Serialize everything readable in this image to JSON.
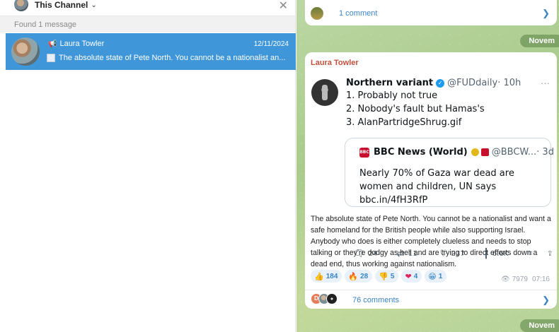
{
  "search": {
    "channel_label": "This Channel",
    "found_label": "Found 1 message",
    "result": {
      "author": "Laura Towler",
      "date": "12/11/2024",
      "snippet": "The absolute state of Pete North. You cannot be a nationalist an..."
    }
  },
  "chat": {
    "top_card": {
      "comments": "1 comment"
    },
    "date_pill_top": "Novem",
    "date_pill_bottom": "Novem",
    "message": {
      "author": "Laura Towler",
      "tweet": {
        "name": "Northern variant",
        "handle": "@FUDdaily",
        "time": "· 10h",
        "lines": [
          "1. Probably not true",
          "2. Nobody's fault but Hamas's",
          "3. AlanPartridgeShrug.gif"
        ],
        "quote": {
          "name": "BBC News (World)",
          "handle": "@BBCW...",
          "time": "· 3d",
          "text": "Nearly 70% of Gaza war dead are women and children, UN says bbc.in/4fH3RfP"
        },
        "stats": {
          "replies": "24",
          "retweets": "11",
          "likes": "237",
          "views": "6.6K"
        }
      },
      "body": "The absolute state of Pete North. You cannot be a nationalist and want a safe homeland for the British people while also supporting Israel. Anybody who does is either completely clueless and needs to stop talking or they're dodgy as hell and are trying to direct efforts down a dead end, thus working against nationalism.",
      "reactions": [
        {
          "emoji": "👍",
          "count": "184"
        },
        {
          "emoji": "🔥",
          "count": "28"
        },
        {
          "emoji": "👎",
          "count": "5"
        },
        {
          "emoji": "❤",
          "count": "4"
        },
        {
          "emoji": "😁",
          "count": "1"
        }
      ],
      "views": "7979",
      "time": "07:16",
      "comments": "76 comments",
      "commenter_initial": "D"
    }
  },
  "colors": {
    "accent": "#3f96d9",
    "author": "#c2513c",
    "link": "#3a84c4"
  }
}
